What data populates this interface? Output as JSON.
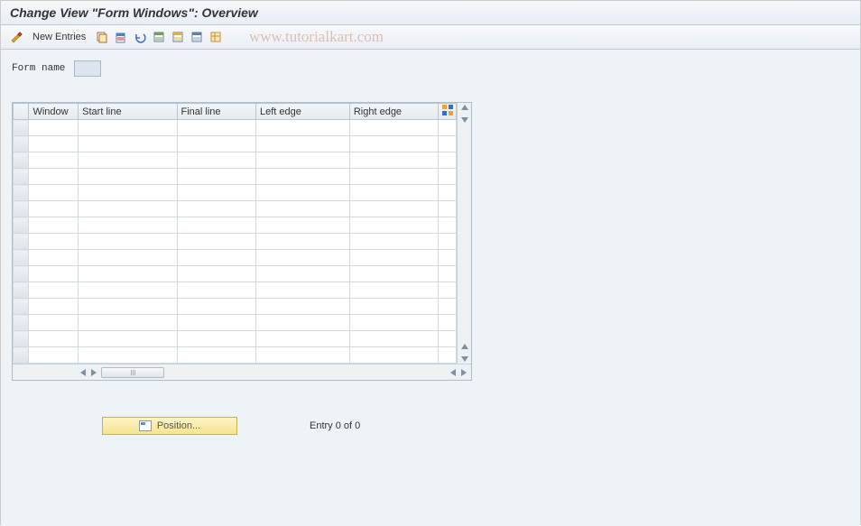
{
  "header": {
    "title": "Change View \"Form Windows\": Overview"
  },
  "toolbar": {
    "new_entries": "New Entries"
  },
  "watermark": "www.tutorialkart.com",
  "form": {
    "name_label": "Form name",
    "name_value": ""
  },
  "table": {
    "columns": [
      "Window",
      "Start line",
      "Final line",
      "Left edge",
      "Right edge"
    ],
    "rows": 15
  },
  "footer": {
    "position_label": "Position...",
    "entry_text": "Entry 0 of 0"
  }
}
